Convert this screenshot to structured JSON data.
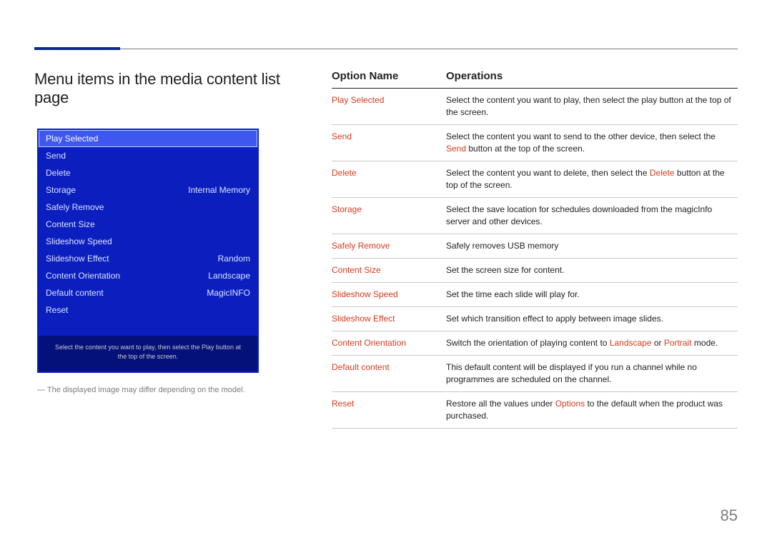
{
  "heading": "Menu items in the media content list page",
  "menu": {
    "items": [
      {
        "label": "Play Selected",
        "value": "",
        "selected": true
      },
      {
        "label": "Send",
        "value": ""
      },
      {
        "label": "Delete",
        "value": ""
      },
      {
        "label": "Storage",
        "value": "Internal Memory"
      },
      {
        "label": "Safely Remove",
        "value": ""
      },
      {
        "label": "Content Size",
        "value": ""
      },
      {
        "label": "Slideshow Speed",
        "value": ""
      },
      {
        "label": "Slideshow Effect",
        "value": "Random"
      },
      {
        "label": "Content Orientation",
        "value": "Landscape"
      },
      {
        "label": "Default content",
        "value": "MagicINFO"
      },
      {
        "label": "Reset",
        "value": ""
      }
    ],
    "help": "Select the content you want to play, then select the Play button at the top of the screen."
  },
  "menu_note": "― The displayed image may differ depending on the model.",
  "table": {
    "head": {
      "name": "Option Name",
      "ops": "Operations"
    },
    "rows": [
      {
        "name": "Play Selected",
        "ops": [
          {
            "t": "Select the content you want to play, then select the play button at the top of the screen."
          }
        ]
      },
      {
        "name": "Send",
        "ops": [
          {
            "t": "Select the content you want to send to the other device, then select the "
          },
          {
            "t": "Send",
            "hl": true
          },
          {
            "t": " button at the top of the screen."
          }
        ]
      },
      {
        "name": "Delete",
        "ops": [
          {
            "t": "Select the content you want to delete, then select the "
          },
          {
            "t": "Delete",
            "hl": true
          },
          {
            "t": " button at the top of the screen."
          }
        ]
      },
      {
        "name": "Storage",
        "ops": [
          {
            "t": "Select the save location for schedules downloaded from the magicInfo server and other devices."
          }
        ]
      },
      {
        "name": "Safely Remove",
        "ops": [
          {
            "t": "Safely removes USB memory"
          }
        ]
      },
      {
        "name": "Content Size",
        "ops": [
          {
            "t": "Set the screen size for content."
          }
        ]
      },
      {
        "name": "Slideshow Speed",
        "ops": [
          {
            "t": "Set the time each slide will play for."
          }
        ]
      },
      {
        "name": "Slideshow Effect",
        "ops": [
          {
            "t": "Set which transition effect to apply between image slides."
          }
        ]
      },
      {
        "name": "Content Orientation",
        "ops": [
          {
            "t": "Switch the orientation of playing content to "
          },
          {
            "t": "Landscape",
            "hl": true
          },
          {
            "t": " or "
          },
          {
            "t": "Portrait",
            "hl": true
          },
          {
            "t": " mode."
          }
        ]
      },
      {
        "name": "Default content",
        "ops": [
          {
            "t": "This default content will be displayed if you run a channel while no programmes are scheduled on the channel."
          }
        ]
      },
      {
        "name": "Reset",
        "ops": [
          {
            "t": "Restore all the values under "
          },
          {
            "t": "Options",
            "hl": true
          },
          {
            "t": " to the default when the product was purchased."
          }
        ]
      }
    ]
  },
  "page_number": "85"
}
